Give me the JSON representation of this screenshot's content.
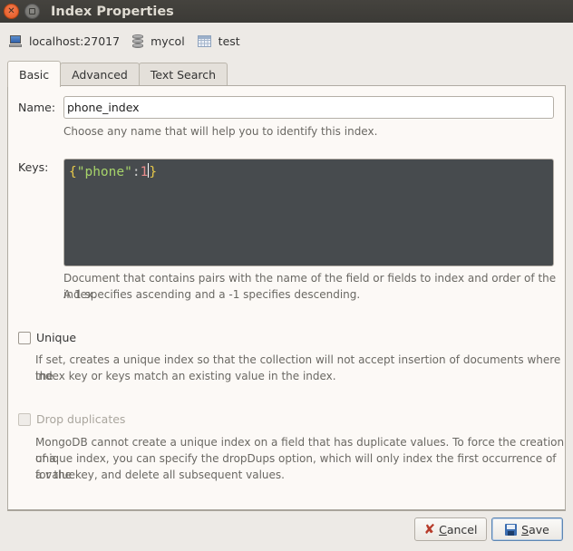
{
  "window": {
    "title": "Index Properties",
    "close_icon": "close-x-icon",
    "maximize_icon": "maximize-square-icon"
  },
  "context": {
    "server": {
      "label": "localhost:27017",
      "icon": "computer-icon"
    },
    "database": {
      "label": "mycol",
      "icon": "database-icon"
    },
    "collection": {
      "label": "test",
      "icon": "table-icon"
    }
  },
  "tabs": [
    {
      "label": "Basic",
      "active": true
    },
    {
      "label": "Advanced",
      "active": false
    },
    {
      "label": "Text Search",
      "active": false
    }
  ],
  "form": {
    "name_label": "Name:",
    "name_value": "phone_index",
    "name_hint": "Choose any name that will help you to identify this index.",
    "keys_label": "Keys:",
    "keys_value": "{\"phone\":1}",
    "keys_tokens": {
      "open": "{",
      "key": "\"phone\"",
      "colon": ":",
      "value": "1",
      "close": "}"
    },
    "keys_hint_line1": "Document that contains pairs with the name of the field or fields to index and order of the index.",
    "keys_hint_line2": "A 1 specifies ascending and a -1 specifies descending.",
    "unique": {
      "label": "Unique",
      "checked": false,
      "enabled": true,
      "hint_line1": "If set, creates a unique index so that the collection will not accept insertion of documents where the",
      "hint_line2": "index key or keys match an existing value in the index."
    },
    "drop_duplicates": {
      "label": "Drop duplicates",
      "checked": false,
      "enabled": false,
      "hint_line1": "MongoDB cannot create a unique index on a field that has duplicate values. To force the creation of a",
      "hint_line2": "unique index, you can specify the dropDups option, which will only index the first occurrence of a value",
      "hint_line3": "for the key, and delete all subsequent values."
    }
  },
  "buttons": {
    "cancel": {
      "mnemonic": "C",
      "rest": "ancel",
      "icon": "cancel-x-icon"
    },
    "save": {
      "mnemonic": "S",
      "rest": "ave",
      "icon": "floppy-disk-icon"
    }
  }
}
